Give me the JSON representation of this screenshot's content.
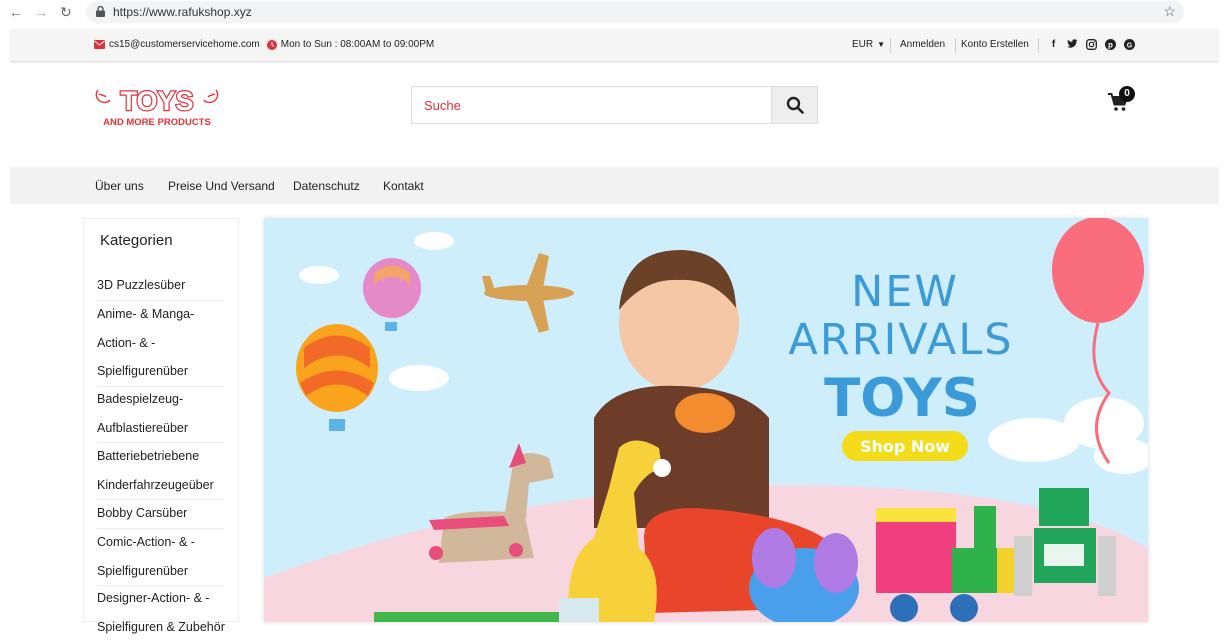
{
  "browser": {
    "url": "https://www.rafukshop.xyz"
  },
  "topbar": {
    "email": "cs15@customerservicehome.com",
    "hours": "Mon to Sun : 08:00AM to 09:00PM",
    "currency": "EUR",
    "login": "Anmelden",
    "register": "Konto Erstellen",
    "social_icons": [
      "facebook-icon",
      "twitter-icon",
      "instagram-icon",
      "pinterest-icon",
      "google-plus-icon"
    ]
  },
  "header": {
    "logo_title": "TOYS",
    "logo_subtitle": "AND MORE PRODUCTS",
    "search_placeholder": "Suche",
    "cart_count": "0"
  },
  "nav": {
    "items": [
      "Über uns",
      "Preise Und Versand",
      "Datenschutz",
      "Kontakt"
    ]
  },
  "sidebar": {
    "title": "Kategorien",
    "categories": [
      "3D Puzzlesüber",
      "Anime- & Manga-Action- & -Spielfigurenüber",
      "Badespielzeug-Aufblastiereüber",
      "Batteriebetriebene Kinderfahrzeugeüber",
      "Bobby Carsüber",
      "Comic-Action- & -Spielfigurenüber",
      "Designer-Action- & -Spielfiguren & Zubehör"
    ]
  },
  "banner": {
    "line1": "NEW",
    "line2": "ARRIVALS",
    "line3": "TOYS",
    "cta": "Shop Now"
  },
  "colors": {
    "accent": "#e1303b",
    "banner_bg": "#cfeefc",
    "banner_text": "#3b9bd8",
    "cta": "#f4dc1a"
  }
}
